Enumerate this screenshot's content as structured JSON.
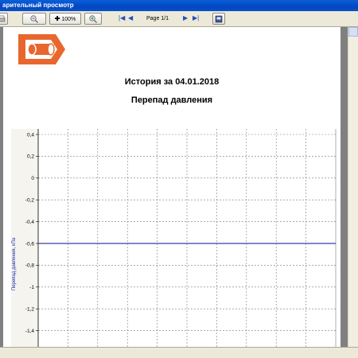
{
  "window": {
    "title": "арительный просмотр"
  },
  "toolbar": {
    "zoom_label": "100%",
    "page_label": "Page 1/1"
  },
  "report": {
    "title": "История за 04.01.2018",
    "subtitle": "Перепад давления"
  },
  "chart_data": {
    "type": "line",
    "title": "",
    "xlabel": "",
    "ylabel": "Перепад давления, кПа",
    "ylim": [
      -1.5,
      0.4
    ],
    "y_ticks": [
      "0,4",
      "0,2",
      "0",
      "-0,2",
      "-0,4",
      "-0,6",
      "-0,8",
      "-1",
      "-1,2",
      "-1,4"
    ],
    "grid": true,
    "series": [
      {
        "values": [
          -0.6,
          -0.6
        ],
        "color": "#3c3ca0"
      }
    ]
  }
}
